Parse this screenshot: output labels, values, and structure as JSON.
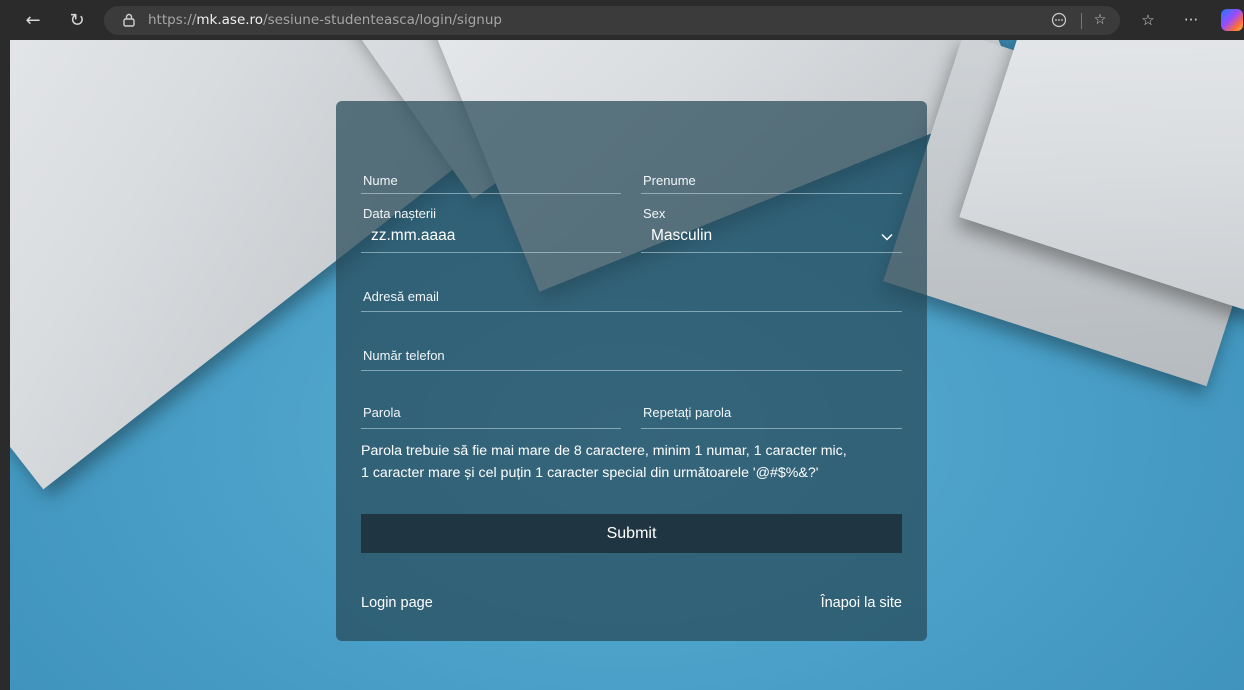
{
  "browser": {
    "url_prefix": "https://",
    "url_domain": "mk.ase.ro",
    "url_path": "/sesiune-studenteasca/login/signup",
    "icons": [
      "back-arrow-icon",
      "reload-icon",
      "lock-icon",
      "more-circle-icon",
      "star-icon",
      "favorites-icon",
      "more-dots-icon",
      "copilot-icon"
    ]
  },
  "form": {
    "nume_label": "Nume",
    "prenume_label": "Prenume",
    "data_label": "Data nașterii",
    "data_value": "zz.mm.aaaa",
    "sex_label": "Sex",
    "sex_value": "Masculin",
    "email_label": "Adresă email",
    "telefon_label": "Număr telefon",
    "parola_label": "Parola",
    "repetati_label": "Repetați parola",
    "note_line1": "Parola trebuie să fie mai mare de 8 caractere, minim 1 numar, 1 caracter mic,",
    "note_line2": "1 caracter mare și cel puțin 1 caracter special din următoarele '@#$%&?'",
    "submit_label": "Submit",
    "login_link": "Login page",
    "back_link": "Înapoi la site"
  },
  "colors": {
    "card": "#264858",
    "submit": "#1f3642",
    "background": "#4aa0c8"
  }
}
